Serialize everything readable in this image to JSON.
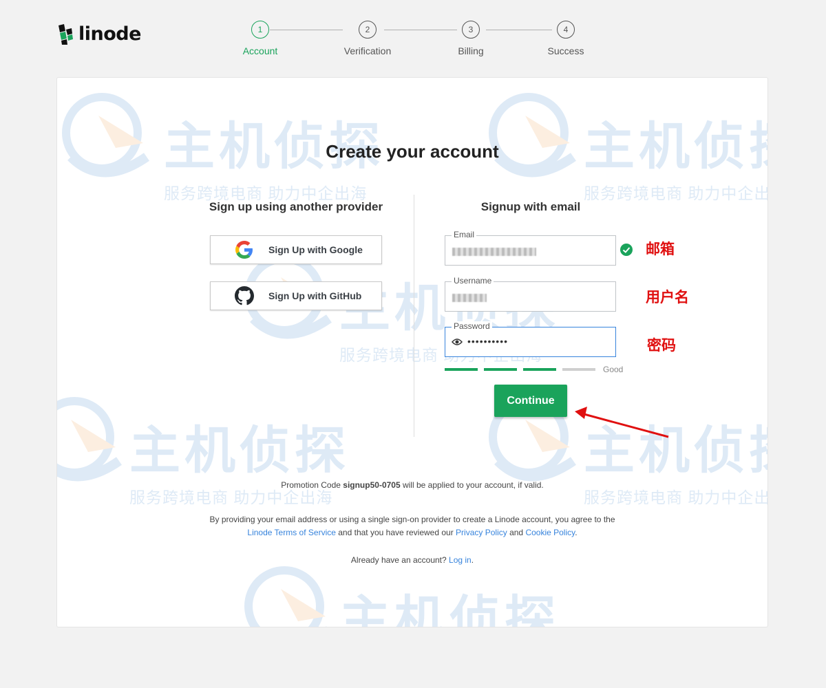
{
  "brand": {
    "name": "linode"
  },
  "stepper": {
    "steps": [
      {
        "number": "1",
        "label": "Account"
      },
      {
        "number": "2",
        "label": "Verification"
      },
      {
        "number": "3",
        "label": "Billing"
      },
      {
        "number": "4",
        "label": "Success"
      }
    ]
  },
  "main": {
    "title": "Create your account",
    "providers": {
      "heading": "Sign up using another provider",
      "google_label": "Sign Up with Google",
      "github_label": "Sign Up with GitHub"
    },
    "email_form": {
      "heading": "Signup with email",
      "email_label": "Email",
      "username_label": "Username",
      "password_label": "Password",
      "password_mask": "••••••••••",
      "strength_label": "Good",
      "continue_label": "Continue"
    },
    "annotations": {
      "email": "邮箱",
      "username": "用户名",
      "password": "密码"
    },
    "promo": {
      "prefix": "Promotion Code ",
      "code": "signup50-0705",
      "suffix": " will be applied to your account, if valid."
    },
    "terms": {
      "line1": "By providing your email address or using a single sign-on provider to create a Linode account, you agree to the",
      "tos_link": "Linode Terms of Service",
      "middle": " and that you have reviewed our ",
      "privacy_link": "Privacy Policy",
      "and": " and ",
      "cookie_link": "Cookie Policy",
      "end": "."
    },
    "login": {
      "prefix": "Already have an account? ",
      "link": "Log in",
      "end": "."
    }
  },
  "watermark": {
    "main": "主机侦探",
    "sub": "服务跨境电商 助力中企出海"
  },
  "colors": {
    "accent": "#1aa35b",
    "link": "#3683dc",
    "annotation": "#e01010"
  }
}
